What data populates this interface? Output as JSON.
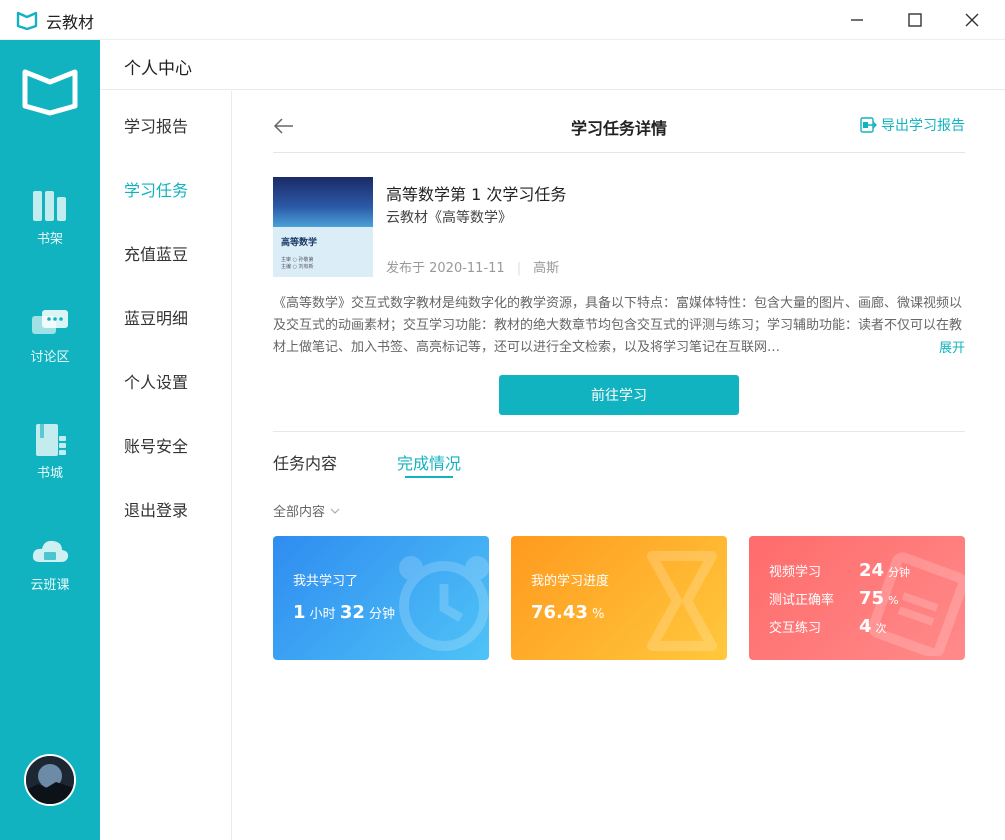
{
  "window": {
    "title": "云教材"
  },
  "rail": {
    "items": [
      {
        "label": "书架",
        "icon": "bookshelf-icon"
      },
      {
        "label": "讨论区",
        "icon": "chat-icon"
      },
      {
        "label": "书城",
        "icon": "bookstore-icon"
      },
      {
        "label": "云班课",
        "icon": "cloud-class-icon"
      }
    ]
  },
  "header": {
    "title": "个人中心"
  },
  "subnav": {
    "items": [
      {
        "label": "学习报告"
      },
      {
        "label": "学习任务"
      },
      {
        "label": "充值蓝豆"
      },
      {
        "label": "蓝豆明细"
      },
      {
        "label": "个人设置"
      },
      {
        "label": "账号安全"
      },
      {
        "label": "退出登录"
      }
    ],
    "active_index": 1
  },
  "main": {
    "title": "学习任务详情",
    "export_label": "导出学习报告",
    "book_cover_title": "高等数学",
    "book_cover_sub1": "主审 ○ 孙敬第",
    "book_cover_sub2": "主编 ○ 刘有新",
    "task_title": "高等数学第 1 次学习任务",
    "task_book": "云教材《高等数学》",
    "publish_label": "发布于 2020-11-11",
    "publisher": "高斯",
    "description": "《高等数学》交互式数字教材是纯数字化的教学资源，具备以下特点：富媒体特性：包含大量的图片、画廊、微课视频以及交互式的动画素材；交互学习功能：教材的绝大数章节均包含交互式的评测与练习；学习辅助功能：读者不仅可以在教材上做笔记、加入书签、高亮标记等，还可以进行全文检索，以及将学习笔记在互联网…",
    "expand_label": "展开",
    "go_button": "前往学习",
    "tabs": [
      {
        "label": "任务内容"
      },
      {
        "label": "完成情况"
      }
    ],
    "active_tab": 1,
    "filter_label": "全部内容"
  },
  "cards": {
    "time": {
      "label": "我共学习了",
      "hours": "1",
      "hours_unit": "小时",
      "minutes": "32",
      "minutes_unit": "分钟"
    },
    "progress": {
      "label": "我的学习进度",
      "value": "76.43",
      "unit": "%"
    },
    "stats": [
      {
        "label": "视频学习",
        "value": "24",
        "unit": "分钟"
      },
      {
        "label": "测试正确率",
        "value": "75",
        "unit": "%"
      },
      {
        "label": "交互练习",
        "value": "4",
        "unit": "次"
      }
    ]
  },
  "colors": {
    "accent": "#12b3c0"
  }
}
